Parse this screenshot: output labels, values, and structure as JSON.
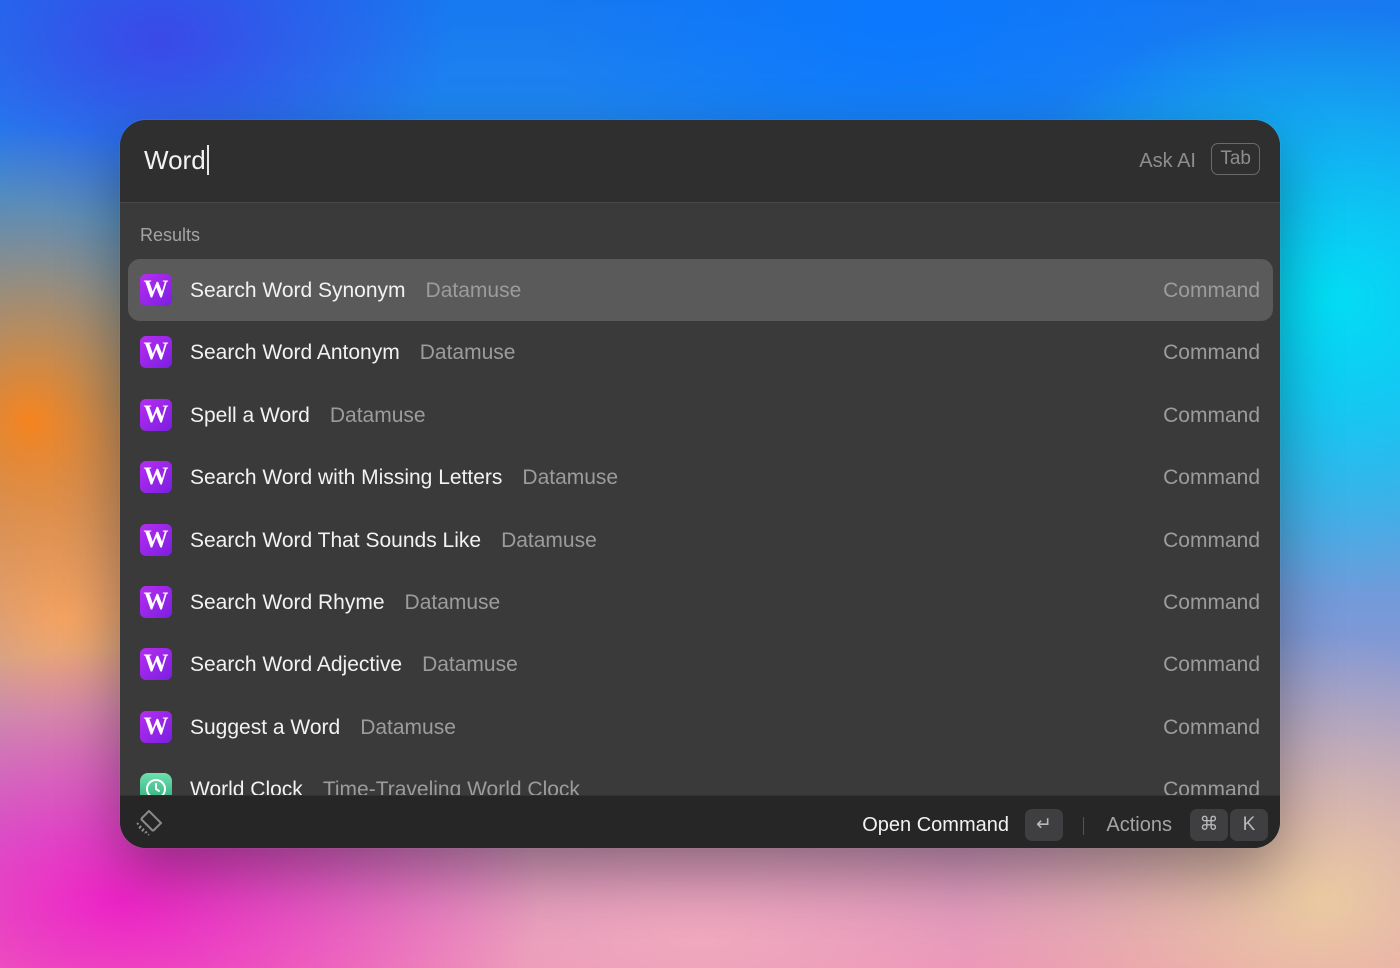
{
  "search": {
    "query": "Word",
    "ask_ai_label": "Ask AI",
    "tab_key": "Tab"
  },
  "results": {
    "section_title": "Results",
    "items": [
      {
        "title": "Search Word Synonym",
        "subtitle": "Datamuse",
        "accessory": "Command",
        "icon": "W",
        "selected": true
      },
      {
        "title": "Search Word Antonym",
        "subtitle": "Datamuse",
        "accessory": "Command",
        "icon": "W"
      },
      {
        "title": "Spell a Word",
        "subtitle": "Datamuse",
        "accessory": "Command",
        "icon": "W"
      },
      {
        "title": "Search Word with Missing Letters",
        "subtitle": "Datamuse",
        "accessory": "Command",
        "icon": "W"
      },
      {
        "title": "Search Word That Sounds Like",
        "subtitle": "Datamuse",
        "accessory": "Command",
        "icon": "W"
      },
      {
        "title": "Search Word Rhyme",
        "subtitle": "Datamuse",
        "accessory": "Command",
        "icon": "W"
      },
      {
        "title": "Search Word Adjective",
        "subtitle": "Datamuse",
        "accessory": "Command",
        "icon": "W"
      },
      {
        "title": "Suggest a Word",
        "subtitle": "Datamuse",
        "accessory": "Command",
        "icon": "W"
      },
      {
        "title": "World Clock",
        "subtitle": "Time-Traveling World Clock",
        "accessory": "Command",
        "icon": "clock-icon"
      }
    ]
  },
  "footer": {
    "logo_icon": "raycast-logo-icon",
    "primary_action_label": "Open Command",
    "primary_action_key": "↵",
    "actions_label": "Actions",
    "actions_key_modifier": "⌘",
    "actions_key": "K"
  },
  "colors": {
    "window_bg": "#3a3a3b",
    "selected_row": "#5a5a5b",
    "icon_purple": "#9b24ea",
    "footer_bg": "#262627"
  }
}
